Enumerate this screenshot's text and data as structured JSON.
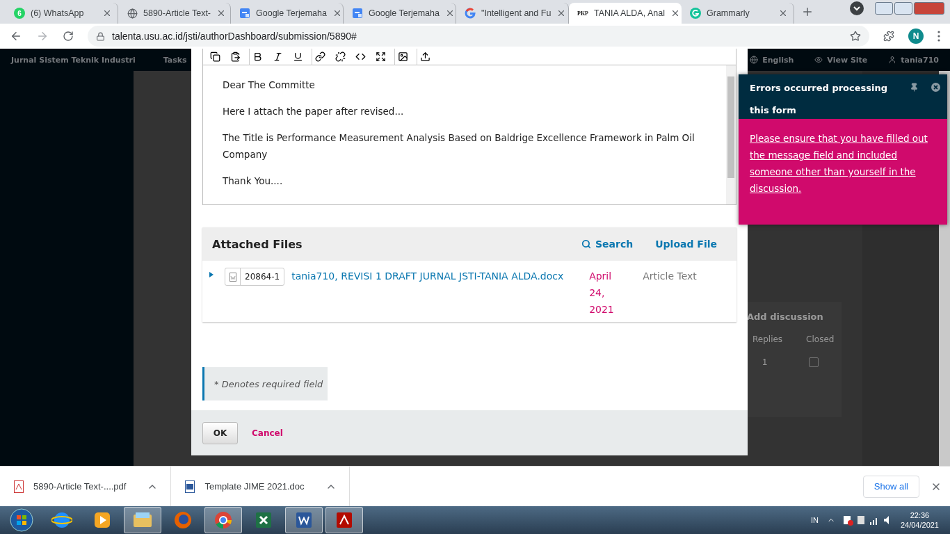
{
  "browser": {
    "tabs": [
      {
        "kind": "whatsapp",
        "badge": "6",
        "title": "(6) WhatsApp",
        "selected": false
      },
      {
        "kind": "globe",
        "title": "5890-Article Text-",
        "selected": false
      },
      {
        "kind": "translate",
        "title": "Google Terjemaha",
        "selected": false
      },
      {
        "kind": "translate",
        "title": "Google Terjemaha",
        "selected": false
      },
      {
        "kind": "google",
        "title": "\"Intelligent and Fu",
        "selected": false
      },
      {
        "kind": "pkp",
        "favicon_text": "PKP",
        "title": "TANIA ALDA, Anal",
        "selected": true
      },
      {
        "kind": "grammarly",
        "title": "Grammarly",
        "selected": false
      }
    ],
    "url": "talenta.usu.ac.id/jsti/authorDashboard/submission/5890#",
    "profile": "N"
  },
  "page": {
    "nav": {
      "site": "Jurnal Sistem Teknik Industri",
      "tasks": "Tasks",
      "language": "English",
      "view_site": "View Site",
      "user": "tania710"
    },
    "discussions": {
      "title": "Add discussion",
      "columns": [
        "Replies",
        "Closed"
      ],
      "rows": [
        {
          "replies": "1",
          "closed": false
        }
      ]
    }
  },
  "modal": {
    "message": [
      "Dear The Committe",
      "Here I attach the paper after revised...",
      "The Title is Performance Measurement Analysis Based on Baldrige Excellence Framework in Palm Oil Company",
      "Thank You...."
    ],
    "attached_files": {
      "title": "Attached Files",
      "search": "Search",
      "upload": "Upload File",
      "files": [
        {
          "id": "20864-1",
          "name": "tania710, REVISI 1 DRAFT JURNAL JSTI-TANIA ALDA.docx",
          "date": "April 24, 2021",
          "type": "Article Text"
        }
      ]
    },
    "note": "* Denotes required field",
    "ok": "OK",
    "cancel": "Cancel"
  },
  "notification": {
    "title": "Errors occurred processing this form",
    "message": "Please ensure that you have filled out the message field and included someone other than yourself in the discussion."
  },
  "downloads": {
    "items": [
      {
        "kind": "pdf",
        "name": "5890-Article Text-....pdf"
      },
      {
        "kind": "word",
        "name": "Template JIME 2021.doc"
      }
    ],
    "show_all": "Show all"
  },
  "taskbar": {
    "apps": [
      {
        "kind": "ie",
        "running": false
      },
      {
        "kind": "media",
        "running": false
      },
      {
        "kind": "explorer",
        "running": true
      },
      {
        "kind": "firefox",
        "running": false
      },
      {
        "kind": "chrome",
        "running": true
      },
      {
        "kind": "excel",
        "running": false
      },
      {
        "kind": "word",
        "running": true
      },
      {
        "kind": "acrobat",
        "running": true
      }
    ],
    "language": "IN",
    "time": "22:36",
    "date": "24/04/2021"
  }
}
